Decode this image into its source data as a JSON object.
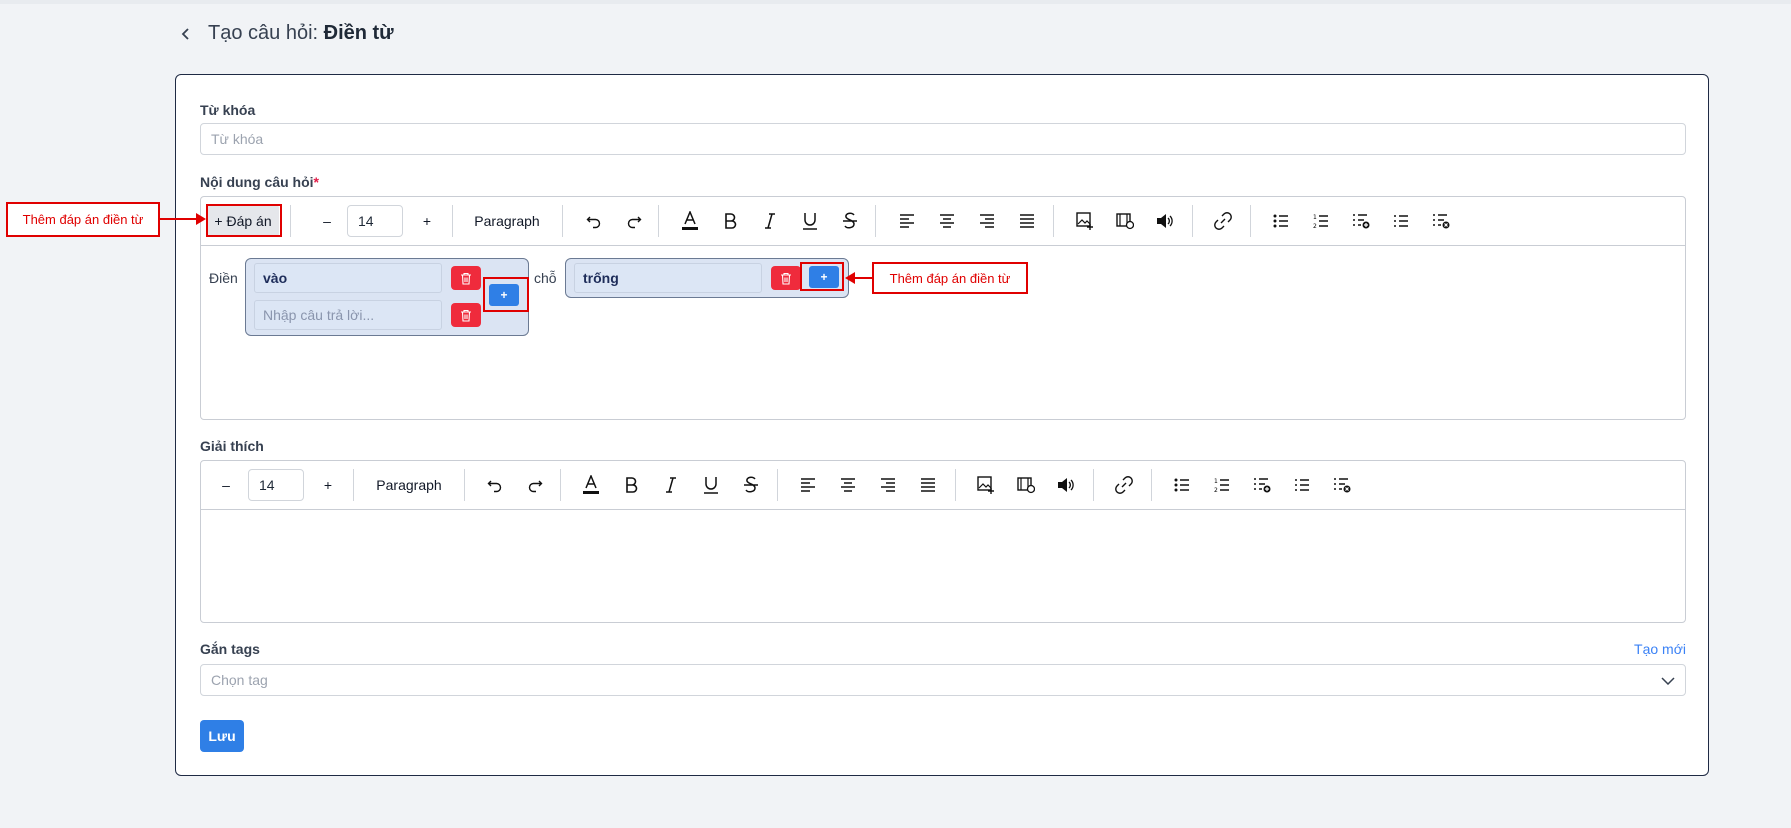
{
  "header": {
    "title_prefix": "Tạo câu hỏi: ",
    "title_bold": "Điền từ"
  },
  "keyword": {
    "label": "Từ khóa",
    "placeholder": "Từ khóa"
  },
  "question": {
    "label": "Nội dung câu hỏi",
    "required_mark": "*",
    "toolbar": {
      "add_answer": "+ Đáp án",
      "minus": "–",
      "font_size": "14",
      "plus": "+",
      "block_type": "Paragraph"
    },
    "content": {
      "word1": "Điền",
      "word2": "chỗ",
      "blank1": {
        "answer1": "vào",
        "answer2_placeholder": "Nhập câu trả lời..."
      },
      "blank2": {
        "answer1": "trống"
      },
      "add_label": "+"
    }
  },
  "explanation": {
    "label": "Giải thích",
    "toolbar": {
      "minus": "–",
      "font_size": "14",
      "plus": "+",
      "block_type": "Paragraph"
    }
  },
  "tags": {
    "label": "Gắn tags",
    "create_new": "Tạo mới",
    "placeholder": "Chọn tag"
  },
  "save_label": "Lưu",
  "annotations": {
    "left_callout": "Thêm đáp án điền từ",
    "right_callout": "Thêm đáp án điền từ"
  },
  "colors": {
    "primary": "#2f7fe6",
    "danger": "#ef2b3c",
    "annotation": "#e00000"
  }
}
